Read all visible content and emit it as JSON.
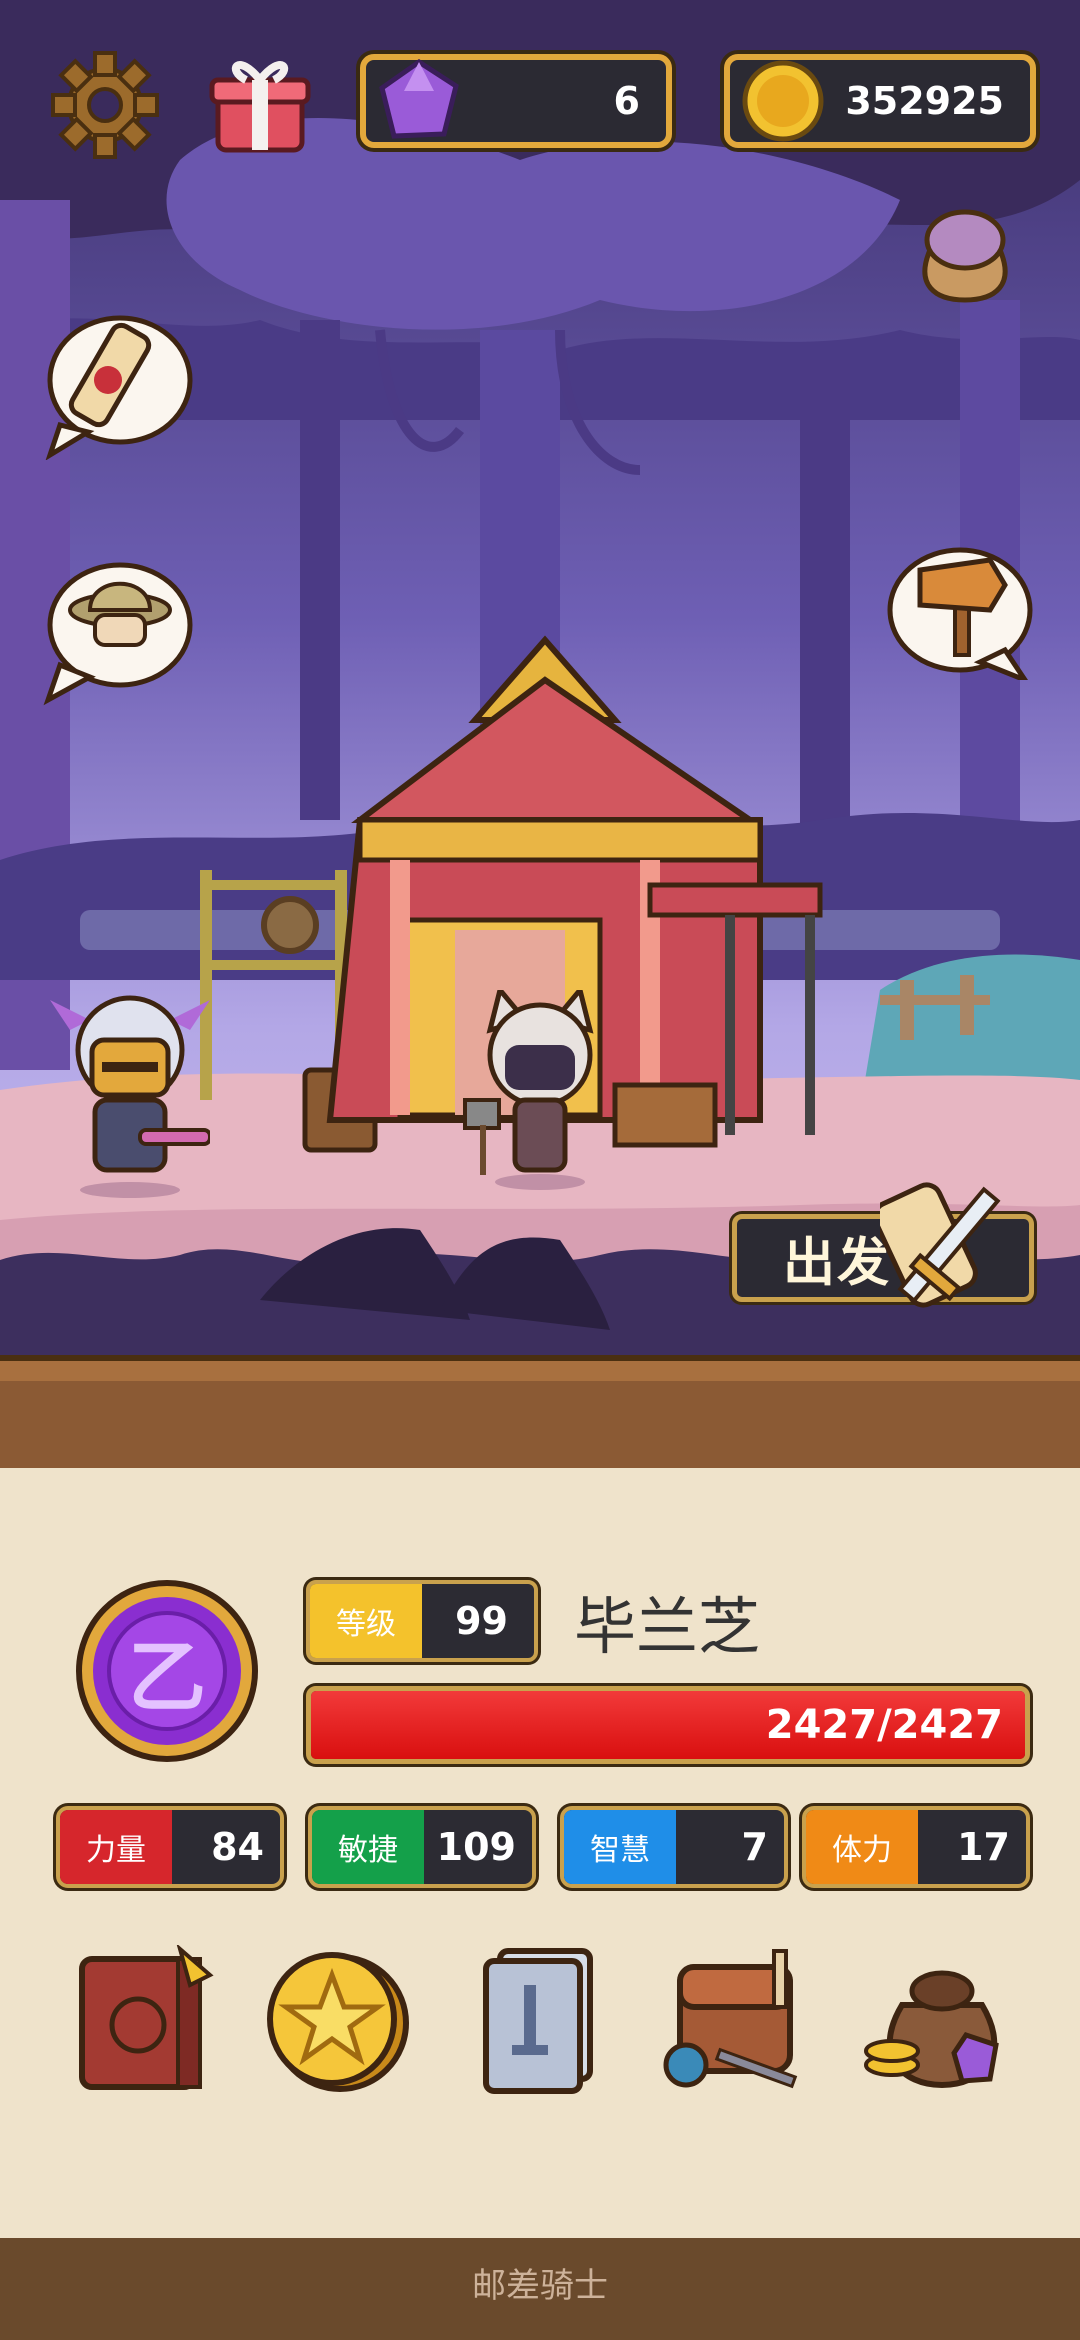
{
  "hud": {
    "gems": "6",
    "coins": "352925"
  },
  "scene": {
    "depart_label": "出发"
  },
  "hero": {
    "level_label": "等级",
    "level_value": "99",
    "name": "毕兰芝",
    "hp_text": "2427/2427",
    "hp_fraction": 1.0,
    "emblem_glyph": "乙"
  },
  "stats": [
    {
      "label": "力量",
      "value": "84",
      "color": "#d6262c"
    },
    {
      "label": "敏捷",
      "value": "109",
      "color": "#14a04a"
    },
    {
      "label": "智慧",
      "value": "7",
      "color": "#1f8ee8"
    },
    {
      "label": "体力",
      "value": "17",
      "color": "#f08a16"
    }
  ],
  "items": [
    "journal-book-icon",
    "star-coin-icon",
    "card-deck-icon",
    "backpack-icon",
    "treasure-bag-icon"
  ],
  "footer": {
    "title": "邮差骑士"
  },
  "colors": {
    "accent_gold": "#e2a83c",
    "hp_red": "#e81c1c",
    "panel_bg": "#efe3cb"
  }
}
